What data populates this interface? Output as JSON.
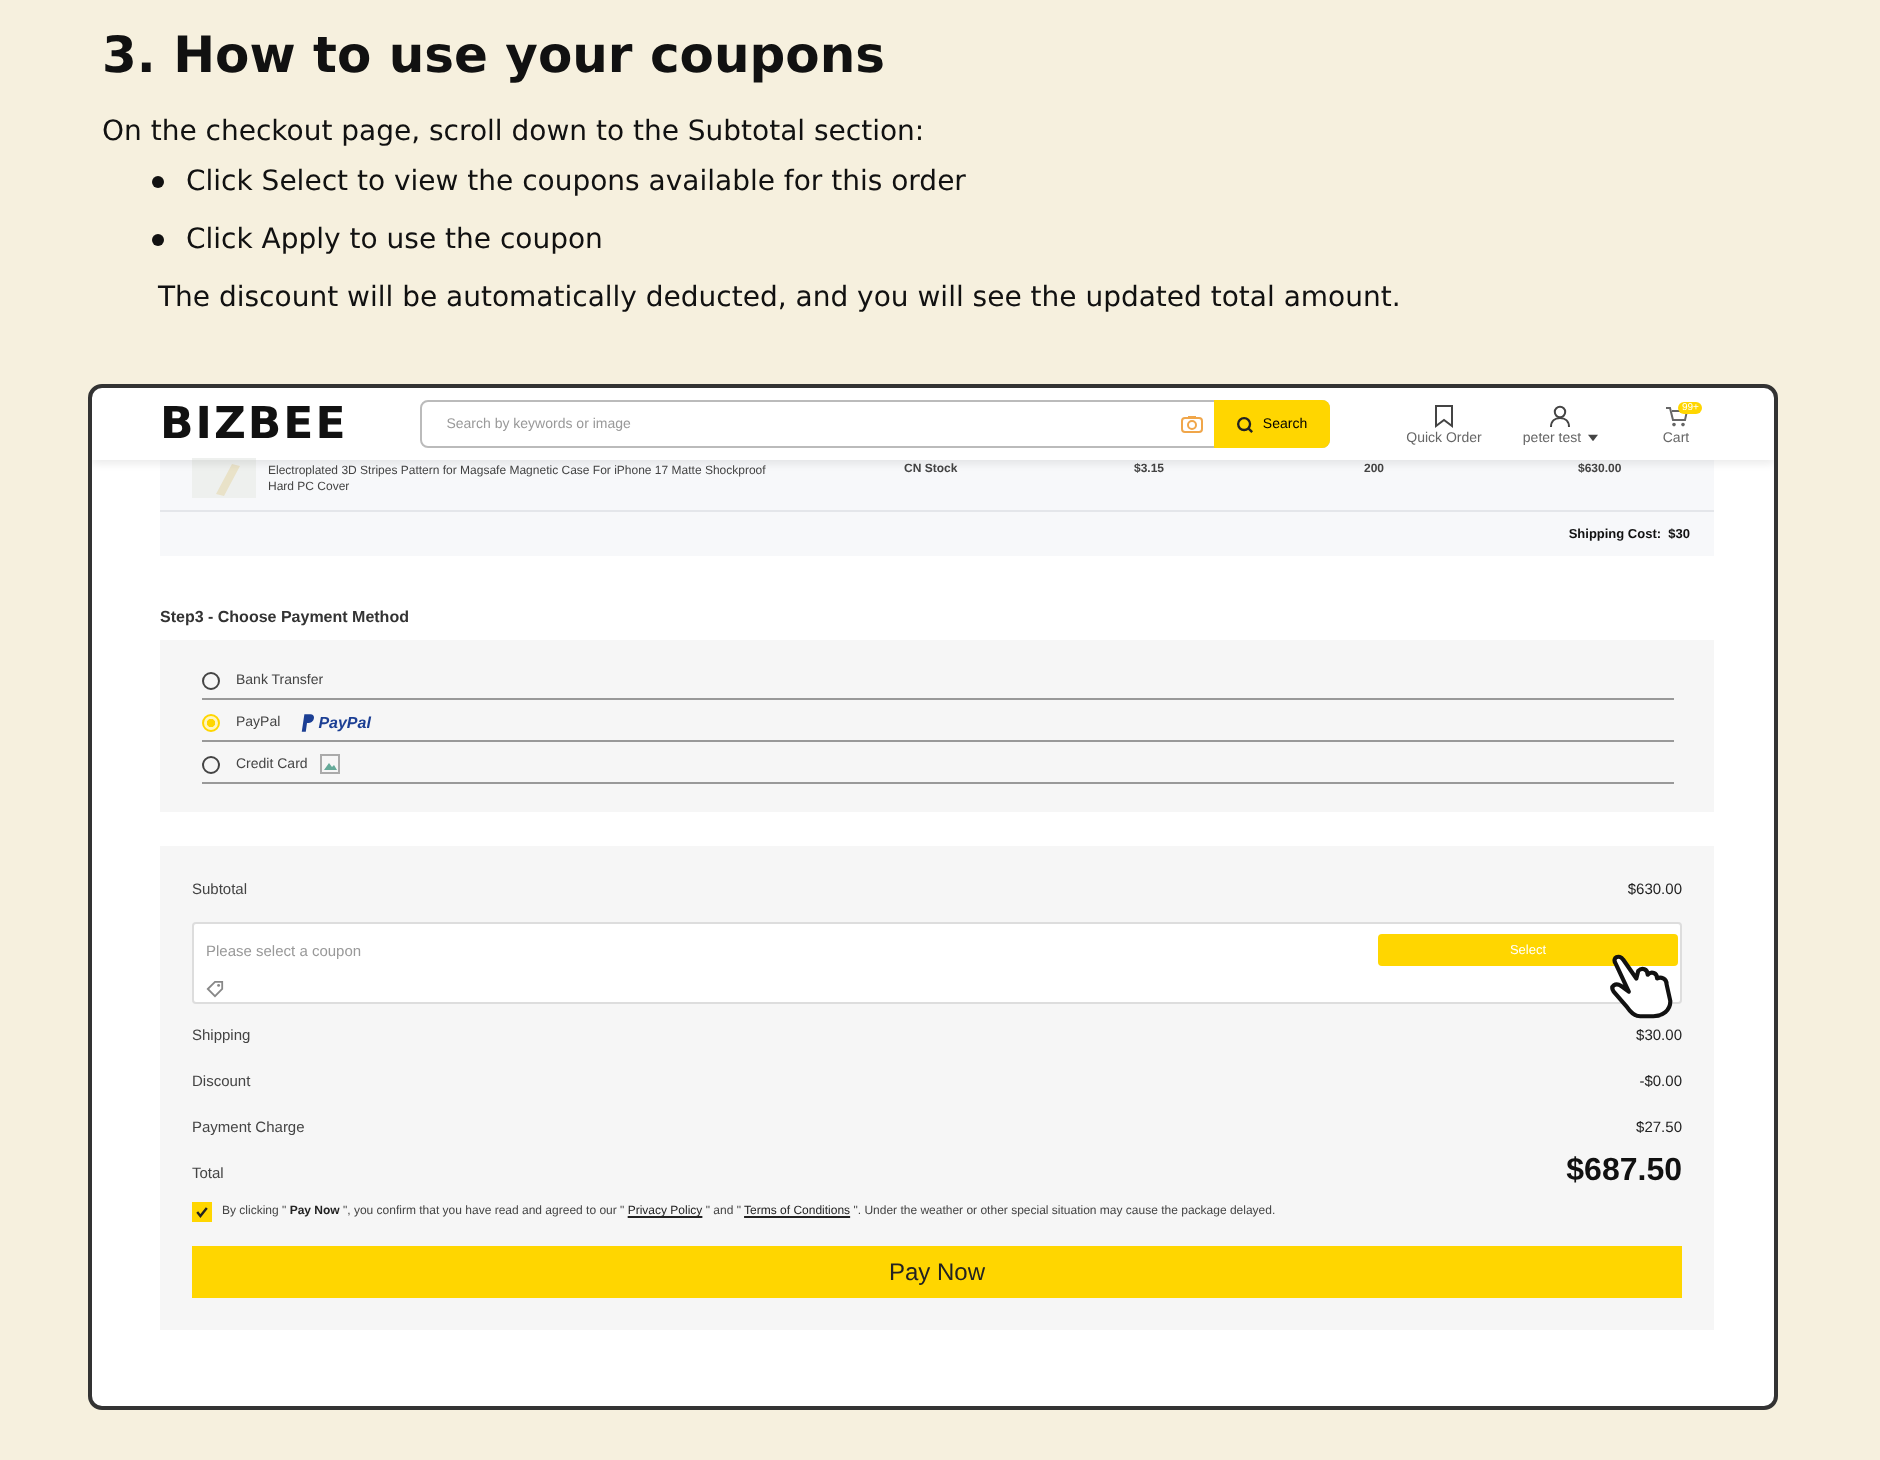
{
  "heading": "3. How to use your coupons",
  "intro": "On the checkout page, scroll down to the Subtotal section:",
  "bullets": [
    "Click Select to view the coupons available for this order",
    "Click Apply to use the coupon"
  ],
  "note": "The discount will be automatically deducted, and you will see the updated total amount.",
  "store": {
    "logo": "BIZBEE",
    "search_placeholder": "Search by keywords or image",
    "search_button": "Search",
    "nav": [
      {
        "kind": "quick",
        "label": "Quick Order"
      },
      {
        "kind": "account",
        "label": "peter test"
      },
      {
        "kind": "cart",
        "label": "Cart",
        "badge": "99+"
      }
    ]
  },
  "product": {
    "name": "Electroplated 3D Stripes Pattern for Magsafe Magnetic Case For iPhone 17 Matte Shockproof Hard PC Cover",
    "stock": "CN Stock",
    "price": "$3.15",
    "quantity": "200",
    "amount": "$630.00"
  },
  "shipping_cost": {
    "label": "Shipping Cost:",
    "value": "$30"
  },
  "payment": {
    "title": "Step3 - Choose Payment Method",
    "methods": [
      {
        "kind": "plain",
        "label": "Bank Transfer",
        "selected": false
      },
      {
        "kind": "paypal",
        "label": "PayPal",
        "logo": "PayPal",
        "selected": true
      },
      {
        "kind": "card",
        "label": "Credit Card",
        "selected": false
      }
    ]
  },
  "summary": {
    "subtotal_label": "Subtotal",
    "subtotal": "$630.00",
    "coupon_placeholder": "Please select a coupon",
    "select_button": "Select",
    "lines": [
      {
        "label": "Shipping",
        "value": "$30.00"
      },
      {
        "label": "Discount",
        "value": "-$0.00"
      },
      {
        "label": "Payment Charge",
        "value": "$27.50"
      }
    ],
    "total_label": "Total",
    "total": "$687.50",
    "agreement": {
      "checked": true,
      "parts": [
        {
          "kind": "text",
          "text": "By clicking \" **Pay Now** \", you confirm that you have read and agreed to our \" "
        },
        {
          "kind": "link",
          "text": "Privacy Policy"
        },
        {
          "kind": "text",
          "text": " \" and \" "
        },
        {
          "kind": "link",
          "text": "Terms of Conditions"
        },
        {
          "kind": "text",
          "text": " \". Under the weather or other special situation may cause the package delayed."
        }
      ]
    },
    "pay_button": "Pay Now"
  }
}
